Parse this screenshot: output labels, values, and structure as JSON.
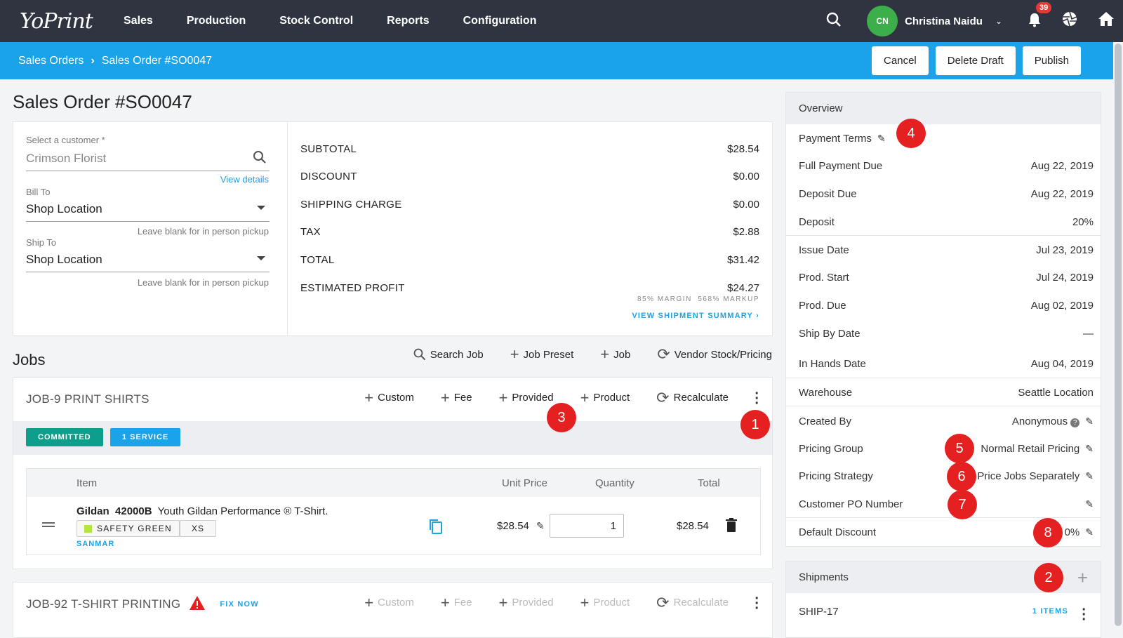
{
  "topnav": {
    "logo": "YoPrint",
    "menu": [
      "Sales",
      "Production",
      "Stock Control",
      "Reports",
      "Configuration"
    ],
    "user_initials": "CN",
    "user_name": "Christina Naidu",
    "notification_count": "39"
  },
  "breadcrumb": {
    "root": "Sales Orders",
    "current": "Sales Order #SO0047",
    "cancel": "Cancel",
    "delete_draft": "Delete Draft",
    "publish": "Publish"
  },
  "page_title": "Sales Order #SO0047",
  "customer": {
    "select_label": "Select a customer *",
    "customer_value": "Crimson Florist",
    "view_details": "View details",
    "bill_to_label": "Bill To",
    "bill_to_value": "Shop Location",
    "bill_hint": "Leave blank for in person pickup",
    "ship_to_label": "Ship To",
    "ship_to_value": "Shop Location",
    "ship_hint": "Leave blank for in person pickup"
  },
  "summary": {
    "rows": [
      {
        "label": "SUBTOTAL",
        "value": "$28.54"
      },
      {
        "label": "DISCOUNT",
        "value": "$0.00"
      },
      {
        "label": "SHIPPING CHARGE",
        "value": "$0.00"
      },
      {
        "label": "TAX",
        "value": "$2.88"
      },
      {
        "label": "TOTAL",
        "value": "$31.42"
      },
      {
        "label": "ESTIMATED PROFIT",
        "value": "$24.27"
      }
    ],
    "margin_note": "85% MARGIN  568% MARKUP",
    "view_shipment": "VIEW SHIPMENT SUMMARY"
  },
  "jobs": {
    "title": "Jobs",
    "actions": [
      "Search Job",
      "Job Preset",
      "Job",
      "Vendor Stock/Pricing"
    ],
    "job_actions": [
      "Custom",
      "Fee",
      "Provided",
      "Product",
      "Recalculate"
    ],
    "job1": {
      "name": "JOB-9 PRINT SHIRTS",
      "tag_committed": "COMMITTED",
      "tag_service": "1 SERVICE",
      "table_headers": {
        "item": "Item",
        "unit_price": "Unit Price",
        "quantity": "Quantity",
        "total": "Total"
      },
      "item_brand": "Gildan",
      "item_sku": "42000B",
      "item_desc": "Youth Gildan Performance ® T-Shirt.",
      "color_chip": "SAFETY GREEN",
      "size_chip": "XS",
      "vendor": "SANMAR",
      "unit_price": "$28.54",
      "quantity": "1",
      "total": "$28.54"
    },
    "job2": {
      "name": "JOB-92 T-SHIRT PRINTING",
      "fix_now": "FIX NOW"
    }
  },
  "overview": {
    "title": "Overview",
    "payment_terms": "Payment Terms",
    "rows_a": [
      {
        "label": "Full Payment Due",
        "value": "Aug 22, 2019"
      },
      {
        "label": "Deposit Due",
        "value": "Aug 22, 2019"
      },
      {
        "label": "Deposit",
        "value": "20%"
      }
    ],
    "rows_b": [
      {
        "label": "Issue Date",
        "value": "Jul 23, 2019"
      },
      {
        "label": "Prod. Start",
        "value": "Jul 24, 2019"
      },
      {
        "label": "Prod. Due",
        "value": "Aug 02, 2019"
      },
      {
        "label": "Ship By Date",
        "value": "—"
      },
      {
        "label": "In Hands Date",
        "value": "Aug 04, 2019"
      }
    ],
    "warehouse_label": "Warehouse",
    "warehouse_value": "Seattle Location",
    "created_by_label": "Created By",
    "created_by_value": "Anonymous",
    "pricing_group_label": "Pricing Group",
    "pricing_group_value": "Normal Retail Pricing",
    "pricing_strategy_label": "Pricing Strategy",
    "pricing_strategy_value": "Price Jobs Separately",
    "customer_po_label": "Customer PO Number",
    "default_discount_label": "Default Discount",
    "default_discount_value": "0%"
  },
  "shipments": {
    "title": "Shipments",
    "ship_id": "SHIP-17",
    "items": "1 ITEMS"
  },
  "markers": [
    "1",
    "2",
    "3",
    "4",
    "5",
    "6",
    "7",
    "8"
  ],
  "colors": {
    "topnav": "#2f3440",
    "breadbar": "#1aa3e8",
    "committed": "#0f9e8c",
    "service": "#1aa3e8",
    "marker": "#e52020"
  }
}
